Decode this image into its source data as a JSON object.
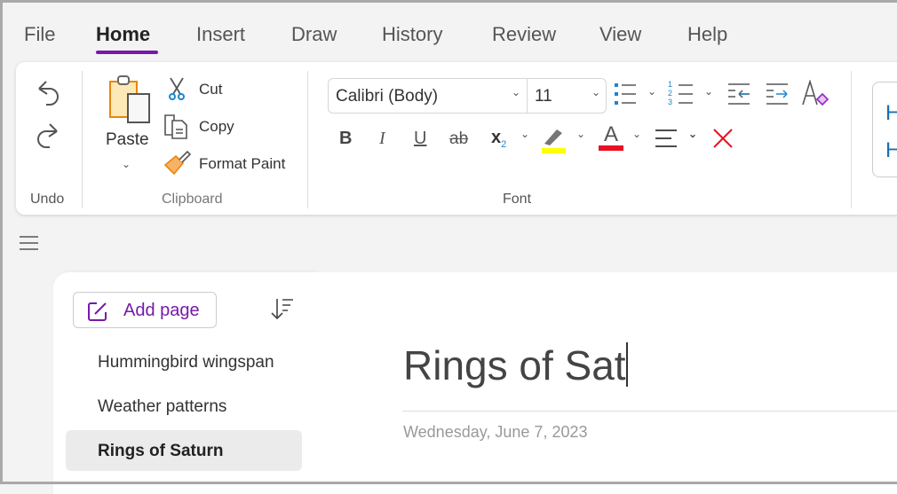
{
  "menu": {
    "tabs": [
      "File",
      "Home",
      "Insert",
      "Draw",
      "History",
      "Review",
      "View",
      "Help"
    ],
    "active": "Home"
  },
  "ribbon": {
    "undo": {
      "group_label": "Undo",
      "undo_icon": "undo-icon",
      "redo_icon": "redo-icon"
    },
    "clipboard": {
      "group_label": "Clipboard",
      "paste": "Paste",
      "cut": "Cut",
      "copy": "Copy",
      "format_paint": "Format Paint"
    },
    "font": {
      "group_label": "Font",
      "font_name": "Calibri (Body)",
      "font_size": "11",
      "subscript_digit": "2",
      "numbered_digits": [
        "1",
        "2",
        "3"
      ],
      "bold": "B",
      "italic": "I",
      "underline": "U",
      "strikethrough": "ab",
      "subscript": "x",
      "font_color_glyph": "A",
      "highlight_color": "#ffff00",
      "font_color": "#e81123"
    },
    "styles": {
      "previews": [
        "H",
        "H"
      ]
    }
  },
  "sidebar": {
    "add_page": "Add page",
    "pages": [
      "Hummingbird wingspan",
      "Weather patterns",
      "Rings of Saturn"
    ],
    "selected": "Rings of Saturn"
  },
  "page": {
    "title": "Rings of Sat",
    "date": "Wednesday, June 7, 2023"
  },
  "colors": {
    "accent": "#7719aa",
    "blue_icon": "#1a86d0",
    "red": "#e81123"
  }
}
